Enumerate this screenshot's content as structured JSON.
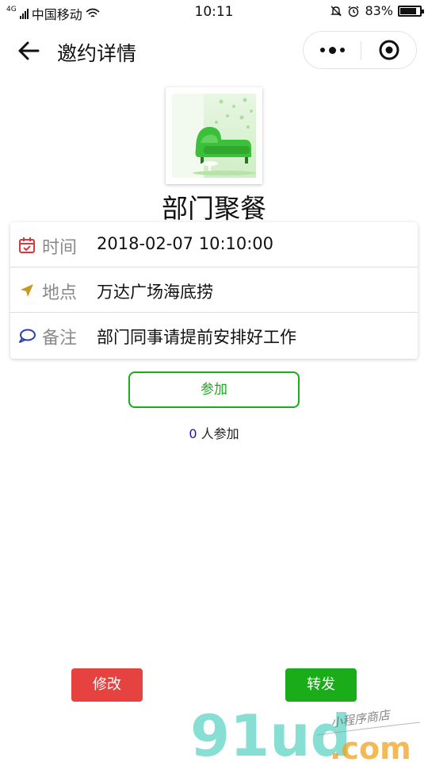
{
  "status_bar": {
    "network": "4G",
    "carrier": "中国移动",
    "time": "10:11",
    "battery_text": "83%",
    "battery_level": 0.83
  },
  "nav": {
    "title": "邀约详情"
  },
  "event": {
    "title": "部门聚餐",
    "rows": [
      {
        "label": "时间",
        "value": "2018-02-07 10:10:00",
        "icon": "calendar-icon",
        "icon_color": "#d9363e"
      },
      {
        "label": "地点",
        "value": "万达广场海底捞",
        "icon": "location-arrow-icon",
        "icon_color": "#c99a1e"
      },
      {
        "label": "备注",
        "value": "部门同事请提前安排好工作",
        "icon": "comment-icon",
        "icon_color": "#2b3fb5"
      }
    ]
  },
  "join_button": {
    "label": "参加"
  },
  "attendance": {
    "count": "0",
    "suffix": " 人参加"
  },
  "actions": {
    "edit_label": "修改",
    "share_label": "转发"
  },
  "watermark": {
    "brand": "91ud",
    "domain": ".com",
    "tagline": "小程序商店"
  },
  "colors": {
    "primary_green": "#1aad19",
    "danger_red": "#e64340",
    "count_blue": "#1a1aa6"
  }
}
